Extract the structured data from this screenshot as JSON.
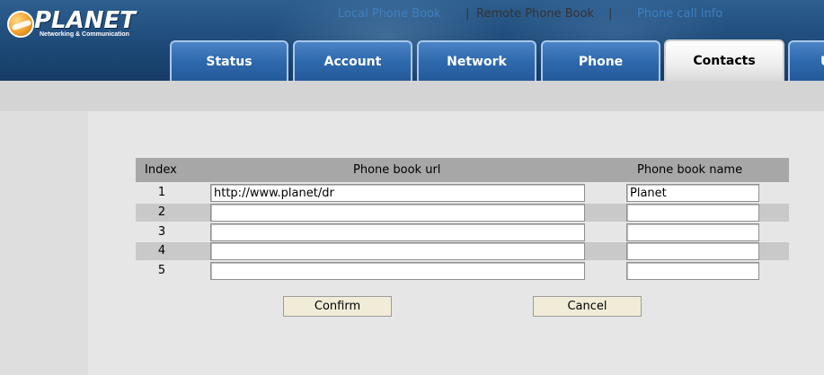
{
  "brand": {
    "name": "PLANET",
    "tagline": "Networking & Communication"
  },
  "tabs": [
    {
      "label": "Status",
      "active": false
    },
    {
      "label": "Account",
      "active": false
    },
    {
      "label": "Network",
      "active": false
    },
    {
      "label": "Phone",
      "active": false
    },
    {
      "label": "Contacts",
      "active": true
    },
    {
      "label": "U",
      "active": false
    }
  ],
  "subnav": {
    "items": [
      {
        "label": "Local Phone Book",
        "current": false
      },
      {
        "label": "Remote Phone Book",
        "current": true
      },
      {
        "label": "Phone call info",
        "current": false
      }
    ],
    "separator": "|"
  },
  "table": {
    "headers": {
      "index": "Index",
      "url": "Phone book url",
      "name": "Phone book name"
    },
    "rows": [
      {
        "index": "1",
        "url": "http://www.planet/dr",
        "name": "Planet"
      },
      {
        "index": "2",
        "url": "",
        "name": ""
      },
      {
        "index": "3",
        "url": "",
        "name": ""
      },
      {
        "index": "4",
        "url": "",
        "name": ""
      },
      {
        "index": "5",
        "url": "",
        "name": ""
      }
    ]
  },
  "buttons": {
    "confirm": "Confirm",
    "cancel": "Cancel"
  },
  "colors": {
    "header_blue": "#1e4a78",
    "tab_blue": "#2f69ad",
    "link_blue": "#3f7fbf",
    "button_bg": "#f0ecd8"
  }
}
